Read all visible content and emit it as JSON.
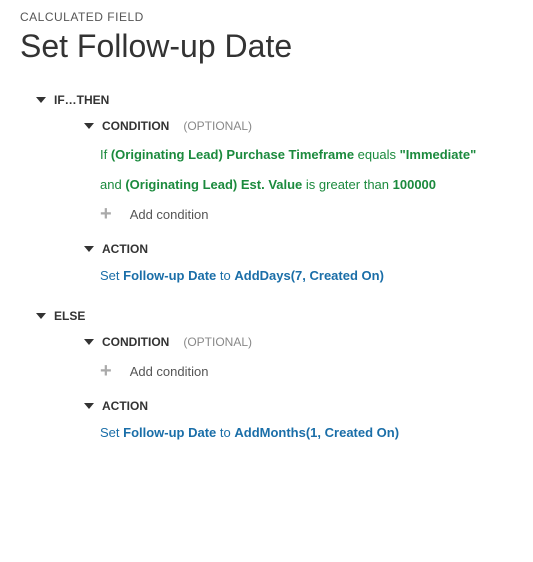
{
  "header": {
    "breadcrumb": "CALCULATED FIELD",
    "title": "Set Follow-up Date"
  },
  "sections": {
    "ifthen": {
      "label": "IF…THEN",
      "condition": {
        "label": "CONDITION",
        "optional": "(OPTIONAL)",
        "line1": {
          "if": "If ",
          "field": "(Originating Lead) Purchase Timeframe",
          "op": " equals ",
          "val": "\"Immediate\""
        },
        "line2": {
          "and": "and ",
          "field": "(Originating Lead) Est. Value",
          "op": " is greater than ",
          "val": "100000"
        },
        "add": "Add condition"
      },
      "action": {
        "label": "ACTION",
        "set": "Set ",
        "field": "Follow-up Date",
        "to": " to ",
        "func": "AddDays(7, Created On)"
      }
    },
    "else": {
      "label": "ELSE",
      "condition": {
        "label": "CONDITION",
        "optional": "(OPTIONAL)",
        "add": "Add condition"
      },
      "action": {
        "label": "ACTION",
        "set": "Set ",
        "field": "Follow-up Date",
        "to": " to ",
        "func": "AddMonths(1, Created On)"
      }
    }
  }
}
